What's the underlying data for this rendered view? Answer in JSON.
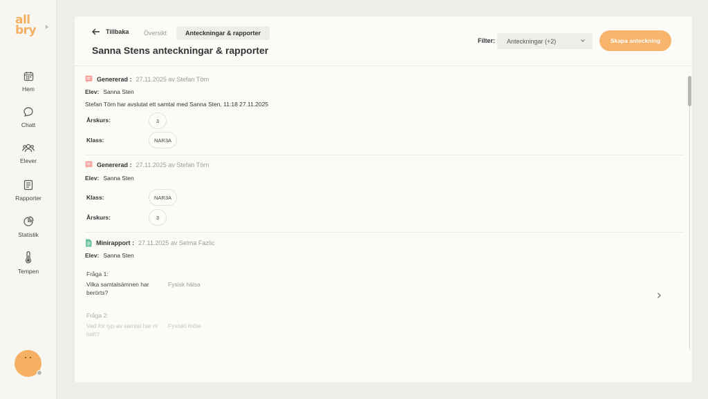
{
  "brand": {
    "logo_top": "all",
    "logo_bottom": "bry",
    "accent": "#f8b46a"
  },
  "sidebar": {
    "items": [
      {
        "label": "Hem",
        "icon": "calendar-icon"
      },
      {
        "label": "Chatt",
        "icon": "chat-bubble-icon"
      },
      {
        "label": "Elever",
        "icon": "users-icon"
      },
      {
        "label": "Rapporter",
        "icon": "report-icon"
      },
      {
        "label": "Statistik",
        "icon": "pie-chart-icon"
      },
      {
        "label": "Tempen",
        "icon": "thermometer-icon"
      }
    ]
  },
  "header": {
    "back_label": "Tillbaka",
    "tabs": [
      {
        "label": "Översikt",
        "active": false
      },
      {
        "label": "Anteckningar & rapporter",
        "active": true
      }
    ],
    "title": "Sanna Stens anteckningar & rapporter",
    "filter_label": "Filter:",
    "filter_value": "Anteckningar (+2)",
    "create_button": "Skapa anteckning"
  },
  "entries": [
    {
      "type": "Genererad :",
      "meta": "27.11.2025 av Stefan Törn",
      "student_label": "Elev:",
      "student": "Sanna Sten",
      "description": "Stefan Törn har avslutat ett samtal med Sanna Sten, 11:18 27.11.2025",
      "fields": [
        {
          "label": "Årskurs:",
          "value": "3"
        },
        {
          "label": "Klass:",
          "value": "NAR3A"
        }
      ]
    },
    {
      "type": "Genererad :",
      "meta": "27.11.2025 av Stefan Törn",
      "student_label": "Elev:",
      "student": "Sanna Sten",
      "fields": [
        {
          "label": "Klass:",
          "value": "NAR3A"
        },
        {
          "label": "Årskurs:",
          "value": "3"
        }
      ]
    },
    {
      "type": "Minirapport :",
      "meta": "27.11.2025 av Selma Fazlic",
      "student_label": "Elev:",
      "student": "Sanna Sten",
      "questions": [
        {
          "label": "Fråga 1:",
          "text": "Vilka samtalsämnen har berörts?",
          "answer": "Fysisk hälsa"
        },
        {
          "label": "Fråga 2:",
          "text": "Vad för typ av samtal har ni haft?",
          "answer": "Fysiskt möte"
        }
      ]
    }
  ]
}
